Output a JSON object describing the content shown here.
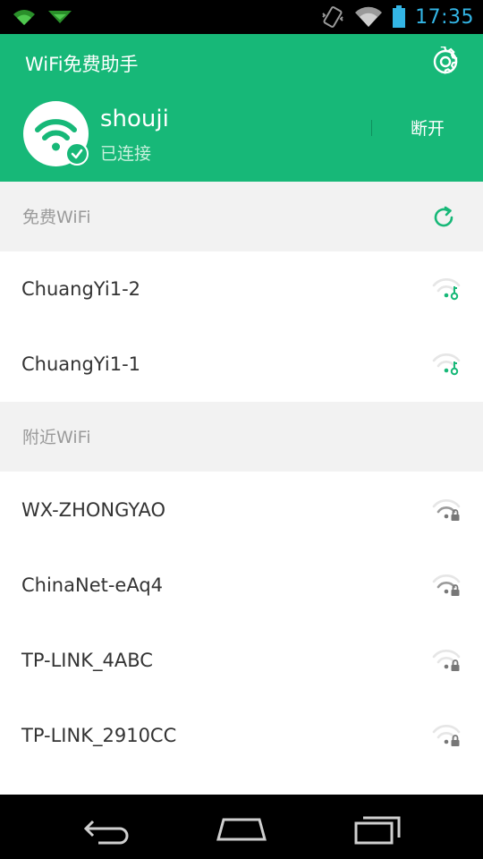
{
  "status_bar": {
    "time": "17:35",
    "icons": [
      "wifi-icon",
      "notification-icon",
      "vibrate-icon",
      "signal-icon",
      "battery-icon"
    ]
  },
  "header": {
    "title": "WiFi免费助手",
    "settings_icon": "gear-icon",
    "connection": {
      "ssid": "shouji",
      "status": "已连接",
      "disconnect_label": "断开"
    }
  },
  "free_wifi": {
    "title": "免费WiFi",
    "refresh_icon": "refresh-icon",
    "networks": [
      {
        "name": "ChuangYi1-2",
        "icon": "wifi-key-icon"
      },
      {
        "name": "ChuangYi1-1",
        "icon": "wifi-key-icon"
      }
    ]
  },
  "nearby_wifi": {
    "title": "附近WiFi",
    "networks": [
      {
        "name": "WX-ZHONGYAO",
        "icon": "wifi-lock-icon"
      },
      {
        "name": "ChinaNet-eAq4",
        "icon": "wifi-lock-icon"
      },
      {
        "name": "TP-LINK_4ABC",
        "icon": "wifi-lock-icon"
      },
      {
        "name": "TP-LINK_2910CC",
        "icon": "wifi-lock-icon"
      }
    ]
  },
  "navigation": {
    "buttons": [
      "back-icon",
      "home-icon",
      "recent-apps-icon"
    ]
  },
  "colors": {
    "primary": "#17b878",
    "status_blue": "#33b5e5",
    "section_bg": "#f2f2f2",
    "text_dark": "#333333",
    "text_gray": "#9a9a9a"
  }
}
